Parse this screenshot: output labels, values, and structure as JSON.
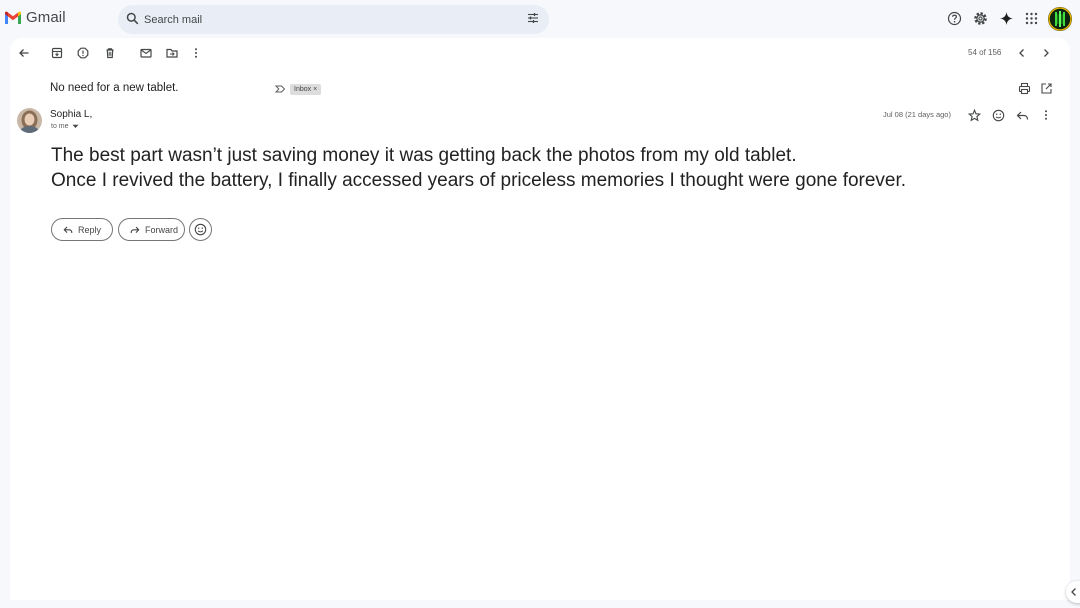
{
  "app": {
    "name": "Gmail"
  },
  "search": {
    "placeholder": "Search mail"
  },
  "pager": {
    "text": "54 of 156"
  },
  "email": {
    "subject": "No need for a new tablet.",
    "label": "Inbox",
    "sender": "Sophia L,",
    "recipient": "to me",
    "date": "Jul 08 (21 days ago)",
    "body_lines": [
      "The best part wasn’t just saving money it was getting back the photos from my old tablet.",
      "Once I revived the battery, I finally accessed years of priceless memories I thought were gone forever."
    ]
  },
  "actions": {
    "reply": "Reply",
    "forward": "Forward"
  },
  "colors": {
    "background": "#f6f8fc",
    "panel": "#ffffff",
    "search_bg": "#e9eef6"
  },
  "icons": {
    "toolbar": [
      "back-arrow-icon",
      "archive-icon",
      "report-spam-icon",
      "delete-icon",
      "mark-unread-icon",
      "move-to-icon",
      "more-vert-icon"
    ],
    "header": [
      "help-icon",
      "settings-icon",
      "gemini-icon",
      "apps-grid-icon",
      "account-avatar"
    ]
  }
}
